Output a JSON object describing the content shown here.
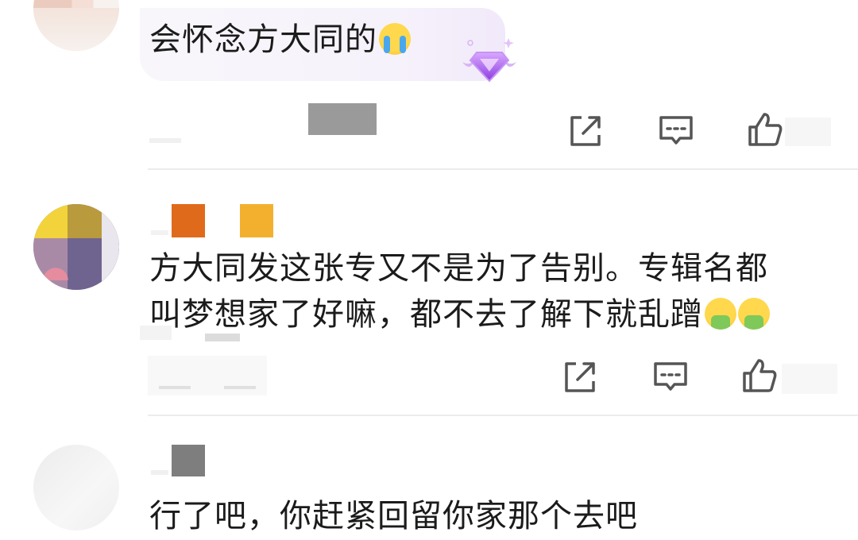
{
  "comments": [
    {
      "text": "会怀念方大同的",
      "emoji": "loudly-crying-face"
    },
    {
      "line1": "方大同发这张专又不是为了告别。专辑名都",
      "line2": "叫梦想家了好嘛，都不去了解下就乱蹭",
      "emoji": "vomiting-face"
    },
    {
      "text": "行了吧，你赶紧回留你家那个去吧"
    }
  ],
  "icons": {
    "share": "share-icon",
    "comment": "comment-icon",
    "like": "thumbs-up-icon",
    "badge": "diamond-badge-icon"
  },
  "colors": {
    "badge_purple": "#b268f0",
    "name_orange": "#e06a1c",
    "name_yellow": "#f3b02f",
    "icon_gray": "#555555"
  }
}
